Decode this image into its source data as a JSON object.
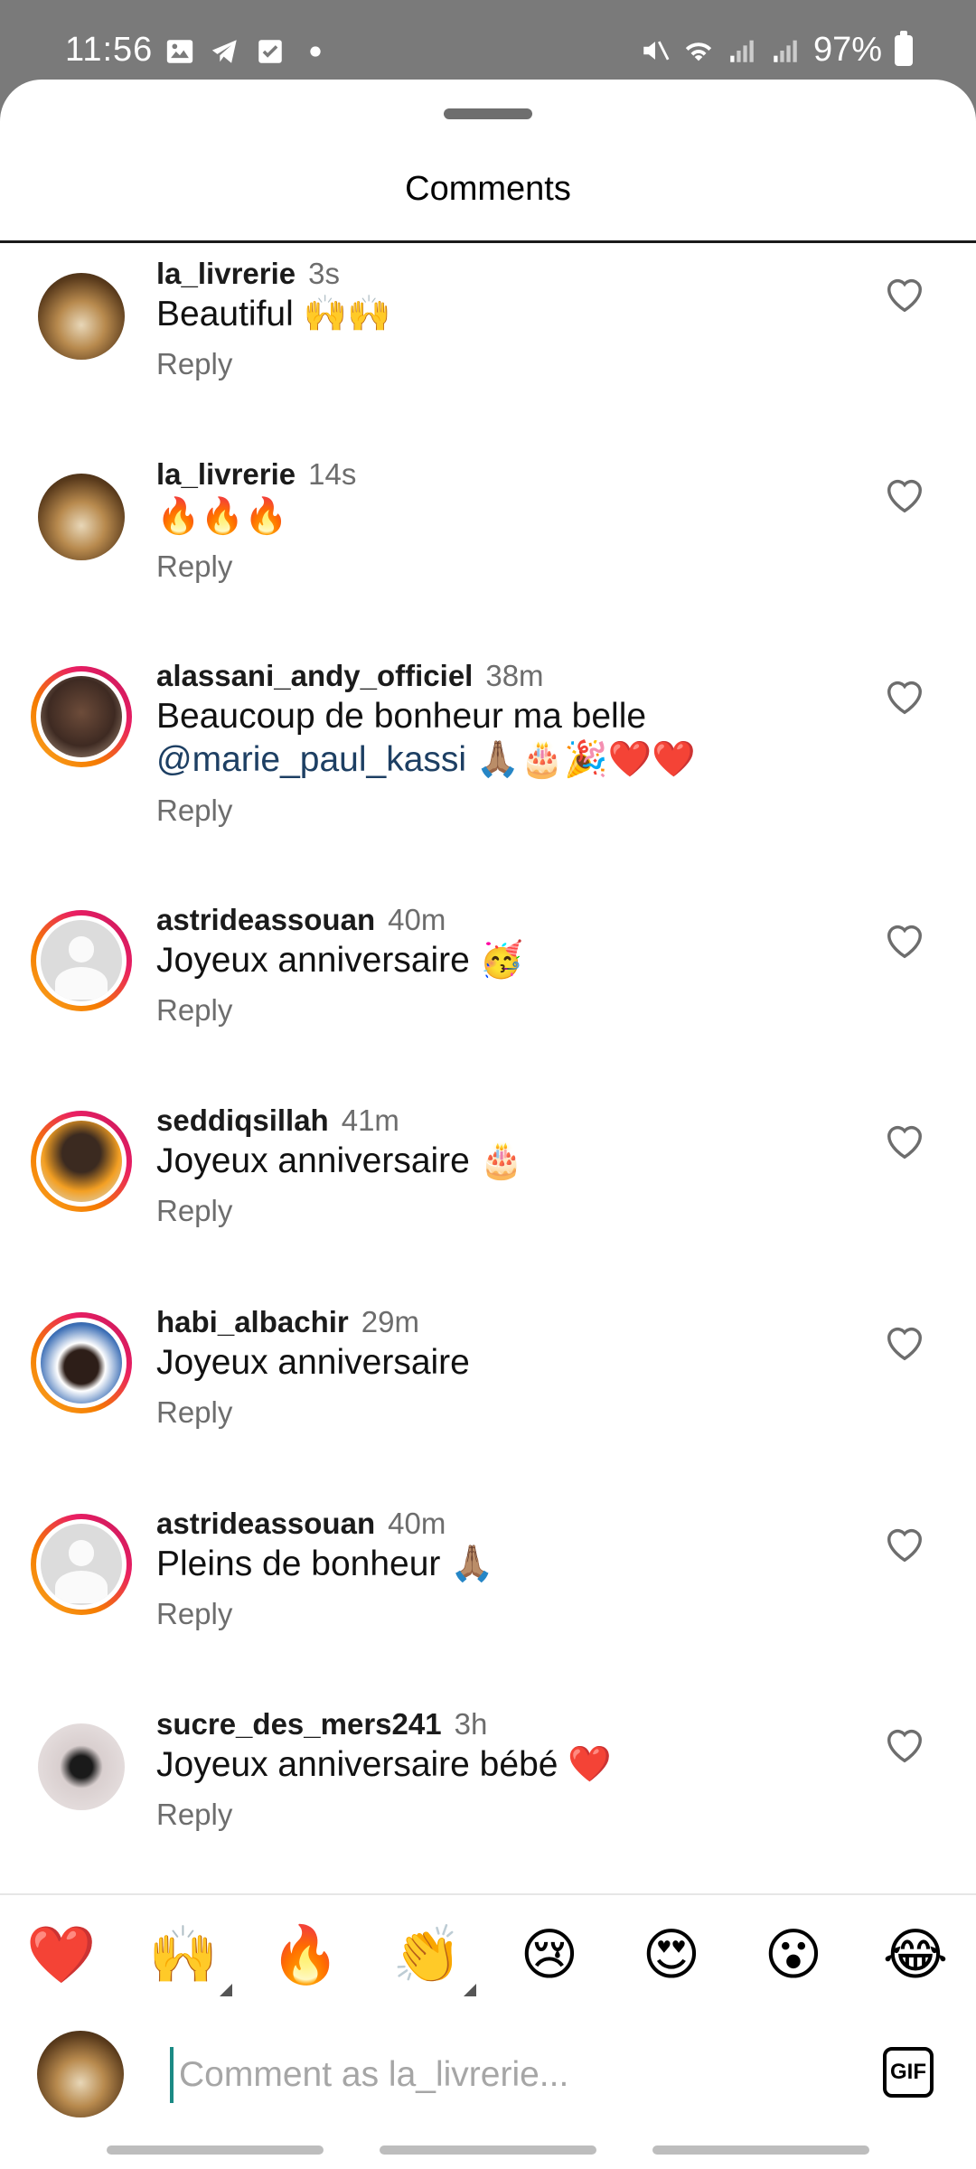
{
  "status_bar": {
    "time": "11:56",
    "battery": "97%"
  },
  "sheet": {
    "title": "Comments"
  },
  "comments": [
    {
      "username": "la_livrerie",
      "time": "3s",
      "text": "Beautiful 🙌🙌",
      "reply": "Reply",
      "avatar": "books-avatar",
      "ring": false
    },
    {
      "username": "la_livrerie",
      "time": "14s",
      "text": "🔥🔥🔥",
      "reply": "Reply",
      "avatar": "books-avatar",
      "ring": false
    },
    {
      "username": "alassani_andy_officiel",
      "time": "38m",
      "text": "Beaucoup de bonheur ma belle",
      "mention": "@marie_paul_kassi",
      "text_tail": " 🙏🏽🎂🎉❤️❤️",
      "reply": "Reply",
      "avatar": "woman-avatar",
      "ring": true
    },
    {
      "username": "astrideassouan",
      "time": "40m",
      "text": "Joyeux anniversaire 🥳",
      "reply": "Reply",
      "avatar": "default-avatar",
      "ring": true
    },
    {
      "username": "seddiqsillah",
      "time": "41m",
      "text": "Joyeux anniversaire 🎂",
      "reply": "Reply",
      "avatar": "man-avatar",
      "ring": true
    },
    {
      "username": "habi_albachir",
      "time": "29m",
      "text": "Joyeux anniversaire",
      "reply": "Reply",
      "avatar": "man-avatar",
      "ring": true
    },
    {
      "username": "astrideassouan",
      "time": "40m",
      "text": "Pleins de bonheur 🙏🏽",
      "reply": "Reply",
      "avatar": "default-avatar",
      "ring": true
    },
    {
      "username": "sucre_des_mers241",
      "time": "3h",
      "text": "Joyeux anniversaire bébé ❤️",
      "reply": "Reply",
      "avatar": "woman-avatar",
      "ring": false
    }
  ],
  "reactions": [
    "❤️",
    "🙌",
    "🔥",
    "👏",
    "😢",
    "😍",
    "😮",
    "😂"
  ],
  "composer": {
    "placeholder": "Comment as la_livrerie...",
    "gif_label": "GIF"
  },
  "colors": {
    "mention": "#1d3f63",
    "cursor": "#1b8a84",
    "story_ring_start": "#f9a825",
    "story_ring_end": "#c2185b"
  }
}
